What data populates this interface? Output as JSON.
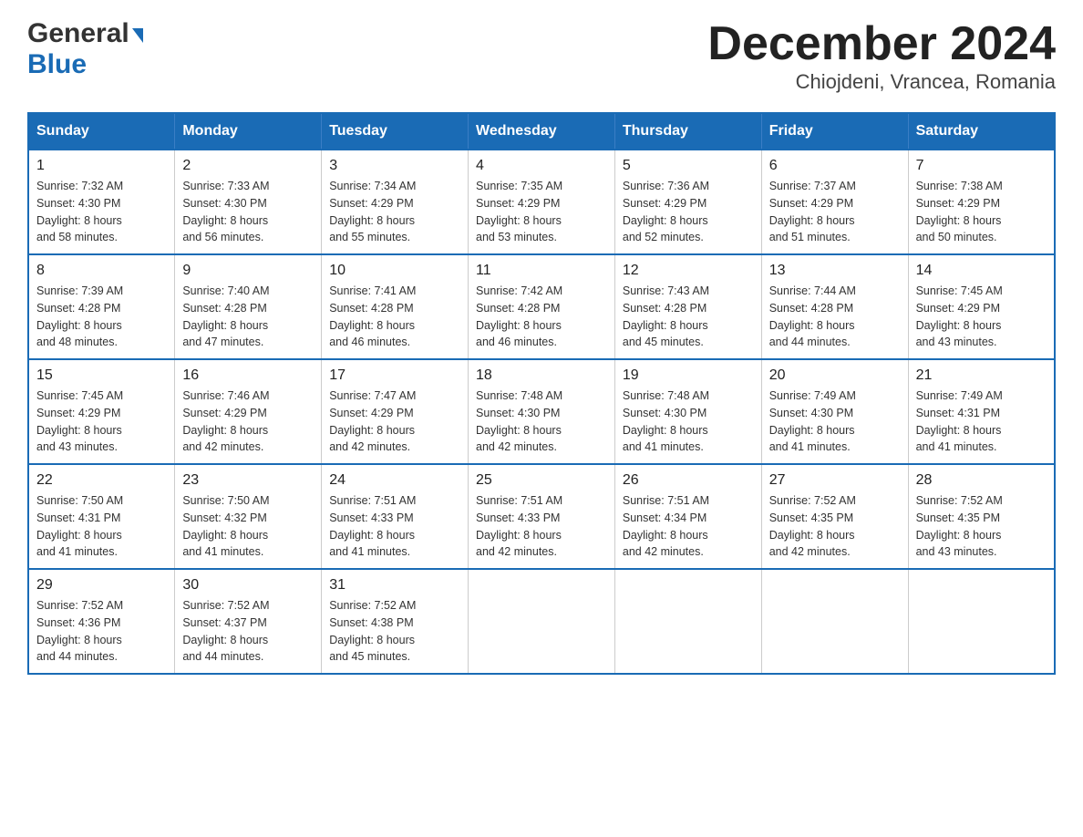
{
  "logo": {
    "general": "General",
    "blue": "Blue"
  },
  "title": "December 2024",
  "subtitle": "Chiojdeni, Vrancea, Romania",
  "days_of_week": [
    "Sunday",
    "Monday",
    "Tuesday",
    "Wednesday",
    "Thursday",
    "Friday",
    "Saturday"
  ],
  "weeks": [
    [
      {
        "day": "1",
        "sunrise": "7:32 AM",
        "sunset": "4:30 PM",
        "daylight": "8 hours and 58 minutes."
      },
      {
        "day": "2",
        "sunrise": "7:33 AM",
        "sunset": "4:30 PM",
        "daylight": "8 hours and 56 minutes."
      },
      {
        "day": "3",
        "sunrise": "7:34 AM",
        "sunset": "4:29 PM",
        "daylight": "8 hours and 55 minutes."
      },
      {
        "day": "4",
        "sunrise": "7:35 AM",
        "sunset": "4:29 PM",
        "daylight": "8 hours and 53 minutes."
      },
      {
        "day": "5",
        "sunrise": "7:36 AM",
        "sunset": "4:29 PM",
        "daylight": "8 hours and 52 minutes."
      },
      {
        "day": "6",
        "sunrise": "7:37 AM",
        "sunset": "4:29 PM",
        "daylight": "8 hours and 51 minutes."
      },
      {
        "day": "7",
        "sunrise": "7:38 AM",
        "sunset": "4:29 PM",
        "daylight": "8 hours and 50 minutes."
      }
    ],
    [
      {
        "day": "8",
        "sunrise": "7:39 AM",
        "sunset": "4:28 PM",
        "daylight": "8 hours and 48 minutes."
      },
      {
        "day": "9",
        "sunrise": "7:40 AM",
        "sunset": "4:28 PM",
        "daylight": "8 hours and 47 minutes."
      },
      {
        "day": "10",
        "sunrise": "7:41 AM",
        "sunset": "4:28 PM",
        "daylight": "8 hours and 46 minutes."
      },
      {
        "day": "11",
        "sunrise": "7:42 AM",
        "sunset": "4:28 PM",
        "daylight": "8 hours and 46 minutes."
      },
      {
        "day": "12",
        "sunrise": "7:43 AM",
        "sunset": "4:28 PM",
        "daylight": "8 hours and 45 minutes."
      },
      {
        "day": "13",
        "sunrise": "7:44 AM",
        "sunset": "4:28 PM",
        "daylight": "8 hours and 44 minutes."
      },
      {
        "day": "14",
        "sunrise": "7:45 AM",
        "sunset": "4:29 PM",
        "daylight": "8 hours and 43 minutes."
      }
    ],
    [
      {
        "day": "15",
        "sunrise": "7:45 AM",
        "sunset": "4:29 PM",
        "daylight": "8 hours and 43 minutes."
      },
      {
        "day": "16",
        "sunrise": "7:46 AM",
        "sunset": "4:29 PM",
        "daylight": "8 hours and 42 minutes."
      },
      {
        "day": "17",
        "sunrise": "7:47 AM",
        "sunset": "4:29 PM",
        "daylight": "8 hours and 42 minutes."
      },
      {
        "day": "18",
        "sunrise": "7:48 AM",
        "sunset": "4:30 PM",
        "daylight": "8 hours and 42 minutes."
      },
      {
        "day": "19",
        "sunrise": "7:48 AM",
        "sunset": "4:30 PM",
        "daylight": "8 hours and 41 minutes."
      },
      {
        "day": "20",
        "sunrise": "7:49 AM",
        "sunset": "4:30 PM",
        "daylight": "8 hours and 41 minutes."
      },
      {
        "day": "21",
        "sunrise": "7:49 AM",
        "sunset": "4:31 PM",
        "daylight": "8 hours and 41 minutes."
      }
    ],
    [
      {
        "day": "22",
        "sunrise": "7:50 AM",
        "sunset": "4:31 PM",
        "daylight": "8 hours and 41 minutes."
      },
      {
        "day": "23",
        "sunrise": "7:50 AM",
        "sunset": "4:32 PM",
        "daylight": "8 hours and 41 minutes."
      },
      {
        "day": "24",
        "sunrise": "7:51 AM",
        "sunset": "4:33 PM",
        "daylight": "8 hours and 41 minutes."
      },
      {
        "day": "25",
        "sunrise": "7:51 AM",
        "sunset": "4:33 PM",
        "daylight": "8 hours and 42 minutes."
      },
      {
        "day": "26",
        "sunrise": "7:51 AM",
        "sunset": "4:34 PM",
        "daylight": "8 hours and 42 minutes."
      },
      {
        "day": "27",
        "sunrise": "7:52 AM",
        "sunset": "4:35 PM",
        "daylight": "8 hours and 42 minutes."
      },
      {
        "day": "28",
        "sunrise": "7:52 AM",
        "sunset": "4:35 PM",
        "daylight": "8 hours and 43 minutes."
      }
    ],
    [
      {
        "day": "29",
        "sunrise": "7:52 AM",
        "sunset": "4:36 PM",
        "daylight": "8 hours and 44 minutes."
      },
      {
        "day": "30",
        "sunrise": "7:52 AM",
        "sunset": "4:37 PM",
        "daylight": "8 hours and 44 minutes."
      },
      {
        "day": "31",
        "sunrise": "7:52 AM",
        "sunset": "4:38 PM",
        "daylight": "8 hours and 45 minutes."
      },
      null,
      null,
      null,
      null
    ]
  ],
  "labels": {
    "sunrise": "Sunrise:",
    "sunset": "Sunset:",
    "daylight": "Daylight:"
  }
}
